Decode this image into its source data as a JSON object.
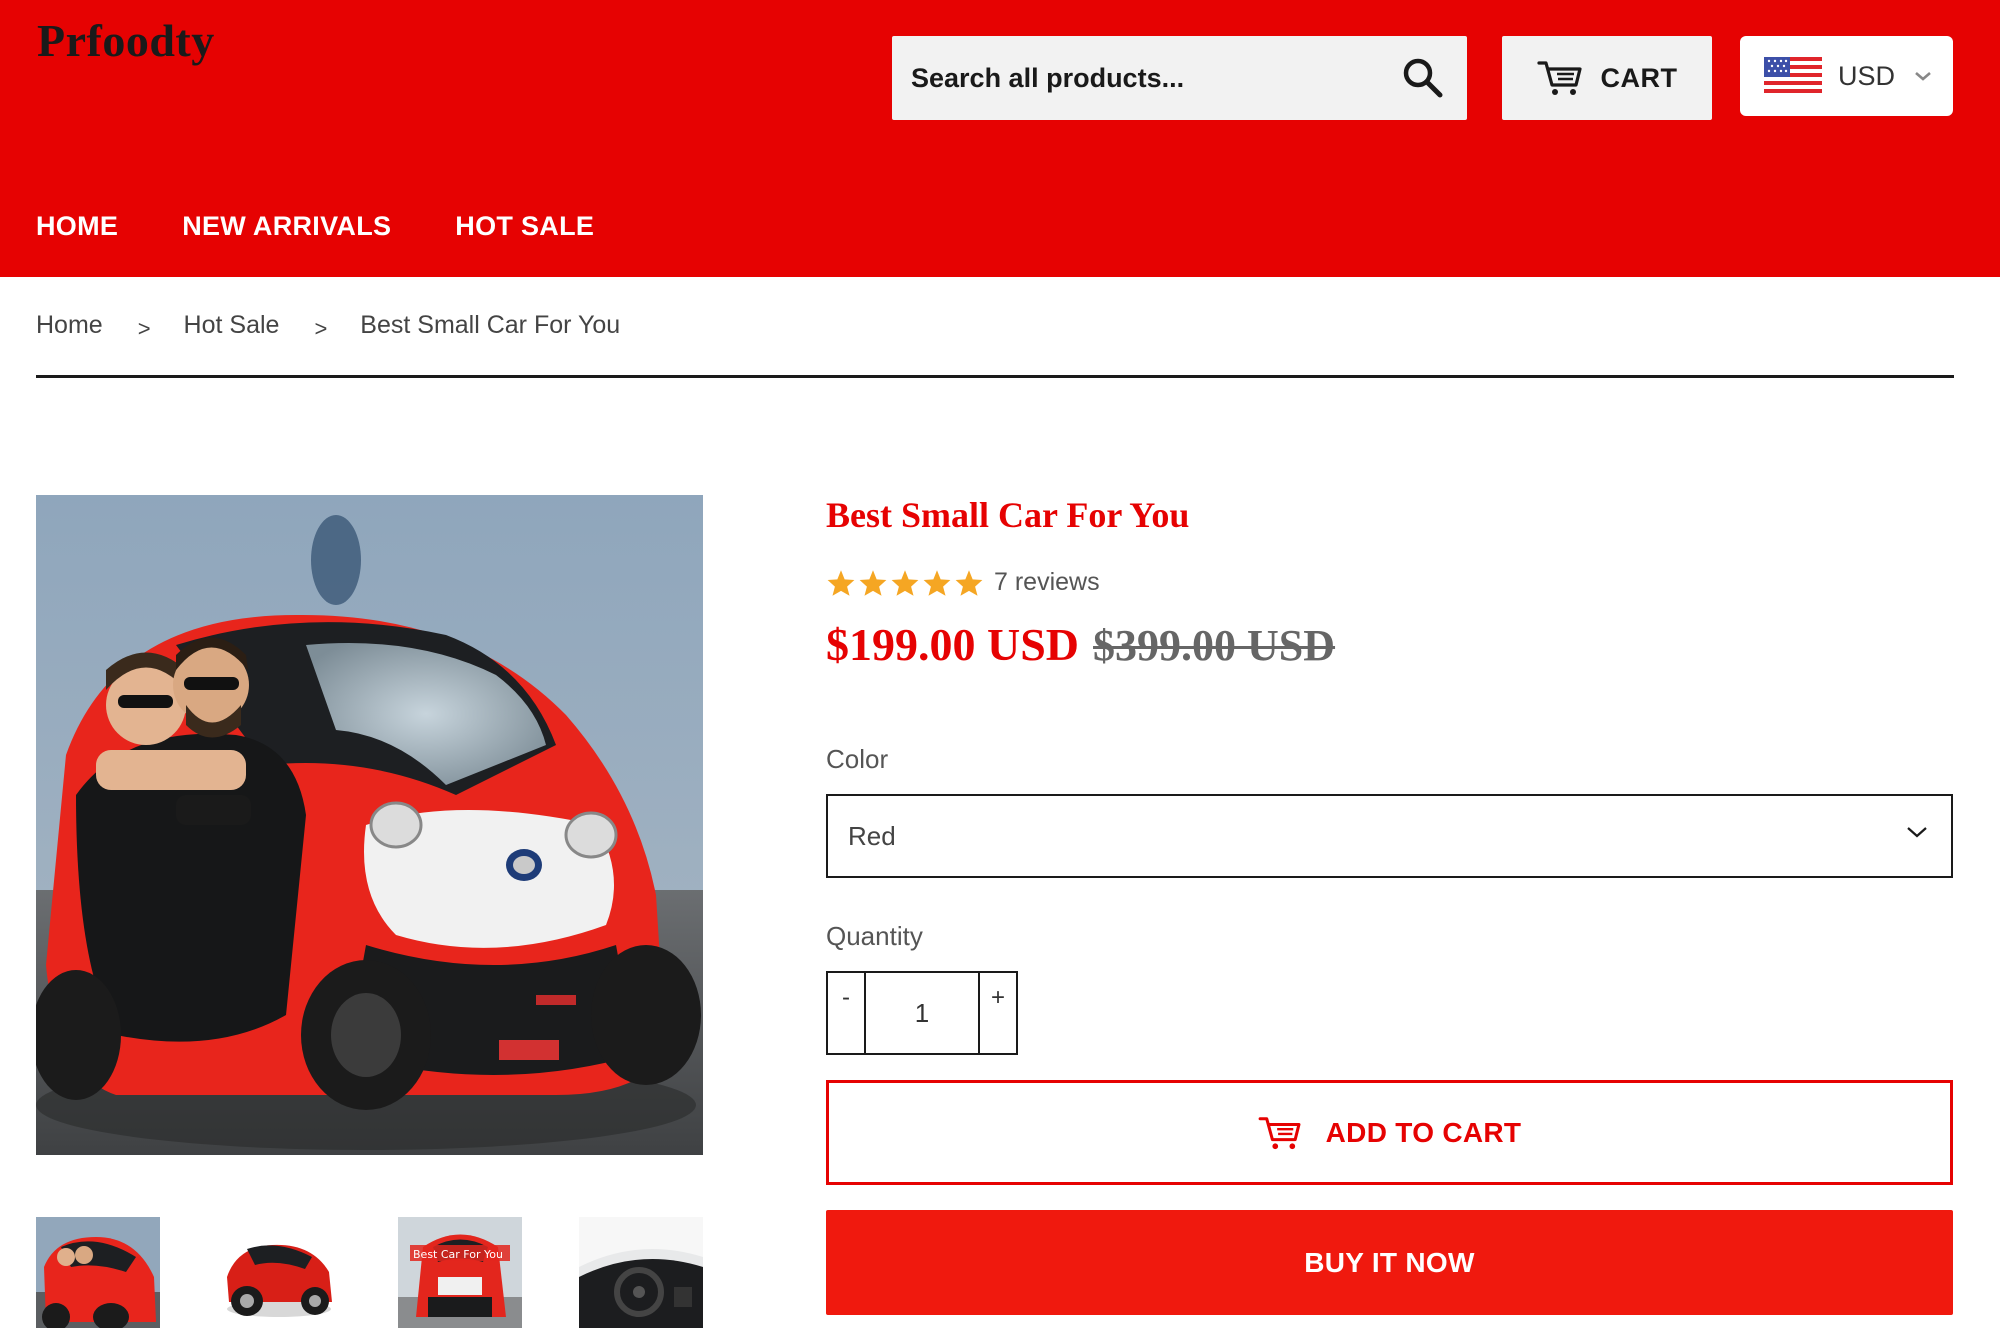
{
  "header": {
    "logo": "Prfoodty",
    "search": {
      "placeholder": "Search all products..."
    },
    "cart_label": "CART",
    "currency": {
      "code": "USD"
    }
  },
  "nav": {
    "items": [
      {
        "label": "HOME"
      },
      {
        "label": "NEW ARRIVALS"
      },
      {
        "label": "HOT SALE"
      }
    ]
  },
  "breadcrumb": {
    "items": [
      {
        "label": "Home"
      },
      {
        "label": "Hot Sale"
      },
      {
        "label": "Best Small Car For You"
      }
    ],
    "separator": ">"
  },
  "product": {
    "title": "Best Small Car For You",
    "rating": {
      "stars": 5,
      "reviews_text": "7 reviews"
    },
    "price": "$199.00 USD",
    "compare_price": "$399.00 USD",
    "color_label": "Color",
    "color_value": "Red",
    "quantity_label": "Quantity",
    "quantity_value": "1",
    "qty_minus": "-",
    "qty_plus": "+",
    "add_to_cart": "ADD TO CART",
    "buy_now": "BUY IT NOW",
    "thumbnail_caption": "Best Car For You"
  },
  "colors": {
    "brand_red": "#e60202",
    "buy_now_red": "#f0190e",
    "star_gold": "#f5a623"
  }
}
